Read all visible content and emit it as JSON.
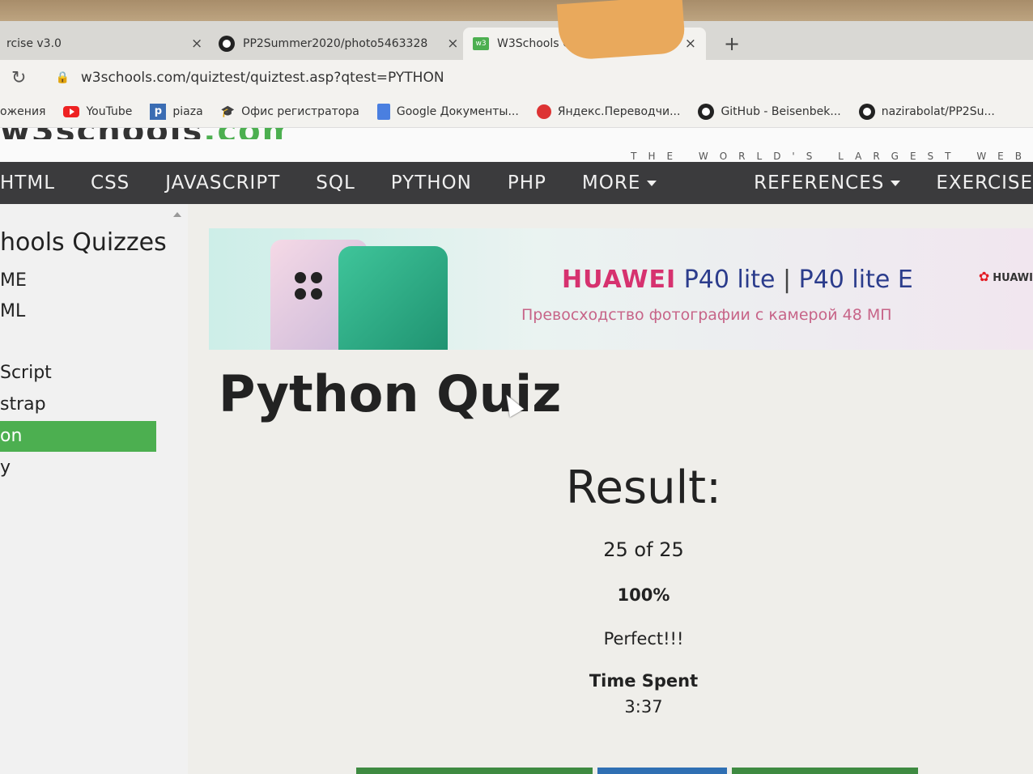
{
  "browser": {
    "tabs": [
      {
        "title": "rcise v3.0",
        "icon": "none"
      },
      {
        "title": "PP2Summer2020/photo5463328",
        "icon": "github-icon"
      },
      {
        "title": "W3Schools Quiz v3.0",
        "icon": "w3schools-icon"
      }
    ],
    "new_tab": "+",
    "close_glyph": "×",
    "url": "w3schools.com/quiztest/quiztest.asp?qtest=PYTHON",
    "bookmarks": [
      {
        "label": "ожения",
        "icon": "none"
      },
      {
        "label": "YouTube",
        "icon": "youtube-icon"
      },
      {
        "label": "piaza",
        "icon": "piazza-icon"
      },
      {
        "label": "Офис регистратора",
        "icon": "graduation-cap-icon"
      },
      {
        "label": "Google Документы...",
        "icon": "google-docs-icon"
      },
      {
        "label": "Яндекс.Переводчи...",
        "icon": "yandex-translate-icon"
      },
      {
        "label": "GitHub - Beisenbek...",
        "icon": "github-icon"
      },
      {
        "label": "nazirabolat/PP2Su...",
        "icon": "github-icon"
      }
    ]
  },
  "site": {
    "tagline": "THE WORLD'S LARGEST WEB",
    "nav": [
      "HTML",
      "CSS",
      "JAVASCRIPT",
      "SQL",
      "PYTHON",
      "PHP",
      "MORE"
    ],
    "nav_right": [
      "REFERENCES",
      "EXERCISE"
    ]
  },
  "sidebar": {
    "title": "hools Quizzes",
    "items": [
      "ME",
      "ML",
      "Script",
      "strap",
      "on",
      "y"
    ],
    "active_index": 4
  },
  "ad": {
    "brand": "HUAWEI",
    "model": "P40 lite",
    "separator": "|",
    "model2": "P40 lite E",
    "subtitle": "Превосходство фотографии с камерой 48 МП",
    "logo": "HUAWI"
  },
  "quiz": {
    "title": "Python Quiz",
    "result_heading": "Result:",
    "score": "25 of 25",
    "percent": "100%",
    "verdict": "Perfect!!!",
    "time_label": "Time Spent",
    "time_value": "3:37"
  },
  "colors": {
    "nav_bg": "#3b3b3d",
    "active_green": "#4caf50",
    "huawei_pink": "#d6326f"
  }
}
